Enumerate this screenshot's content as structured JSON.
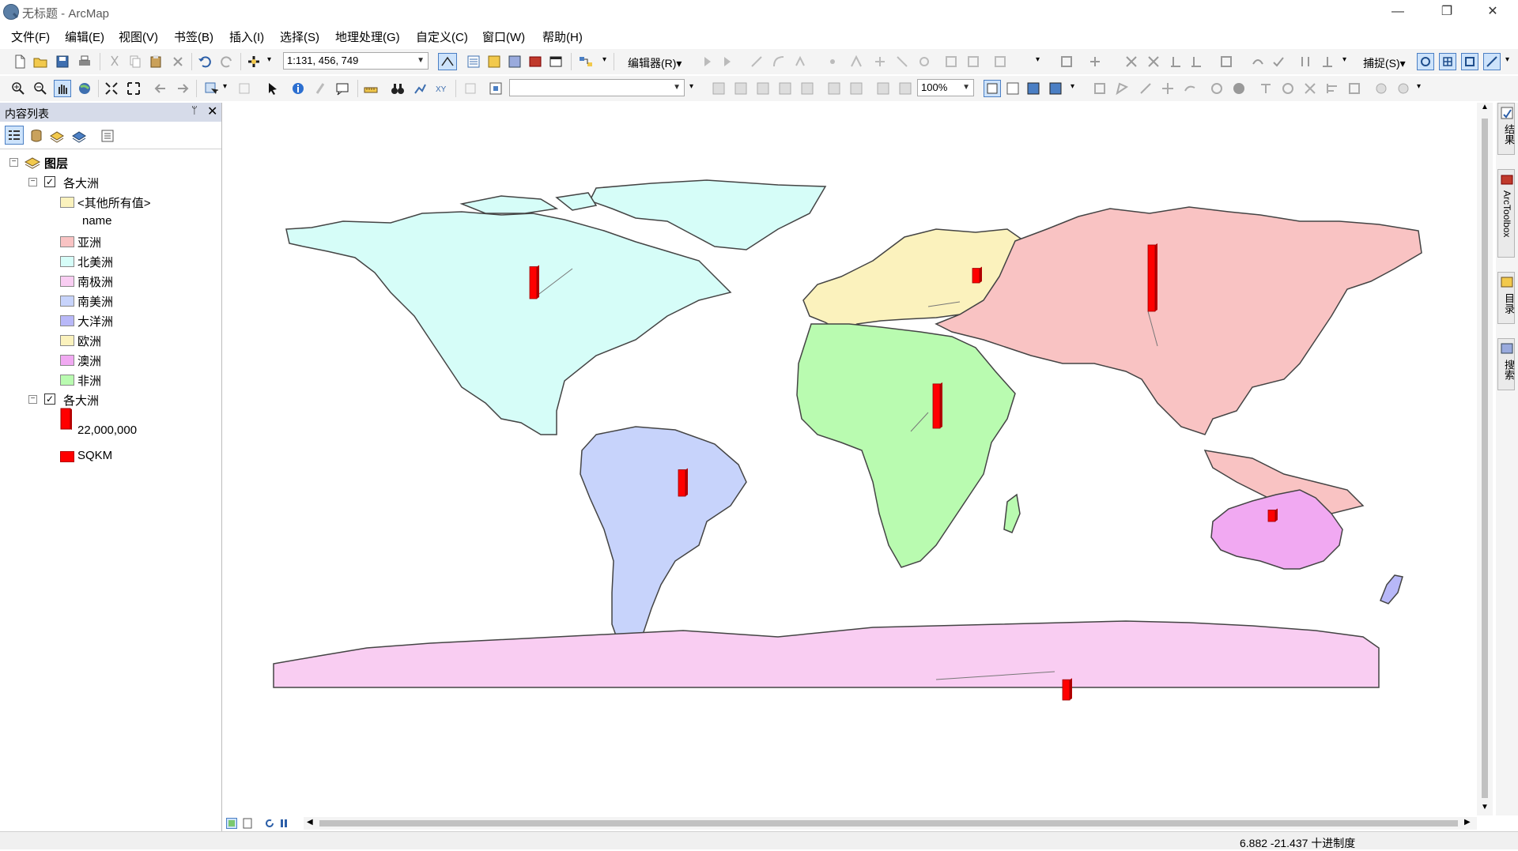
{
  "window": {
    "title": "无标题 - ArcMap",
    "minimize": "—",
    "maximize": "❐",
    "close": "✕"
  },
  "menu": [
    "文件(F)",
    "编辑(E)",
    "视图(V)",
    "书签(B)",
    "插入(I)",
    "选择(S)",
    "地理处理(G)",
    "自定义(C)",
    "窗口(W)",
    "帮助(H)"
  ],
  "toolbar": {
    "scale": "1:131, 456, 749",
    "editor_label": "编辑器(R)▾",
    "snapping_label": "捕捉(S)▾",
    "zoom_percent": "100%"
  },
  "toc": {
    "title": "内容列表",
    "pin": "ᛘ",
    "close": "✕",
    "root": "图层",
    "layer1": {
      "name": "各大洲",
      "other_values": "<其他所有值>",
      "field": "name",
      "classes": [
        {
          "label": "亚洲",
          "color": "#f9c3c3"
        },
        {
          "label": "北美洲",
          "color": "#d6fdf8"
        },
        {
          "label": "南极洲",
          "color": "#f9cdf2"
        },
        {
          "label": "南美洲",
          "color": "#c7d3fb"
        },
        {
          "label": "大洋洲",
          "color": "#b8b8f8"
        },
        {
          "label": "欧洲",
          "color": "#fbf2bd"
        },
        {
          "label": "澳洲",
          "color": "#f1a9f2"
        },
        {
          "label": "非洲",
          "color": "#b9fbb0"
        }
      ],
      "other_color": "#fbf2bd"
    },
    "layer2": {
      "name": "各大洲",
      "size_label": "22,000,000",
      "field": "SQKM",
      "bar_color": "#ff0000"
    }
  },
  "status": {
    "coords": "6.882  -21.437 十进制度"
  },
  "dock": [
    "结果",
    "ArcToolbox",
    "目录",
    "搜索"
  ],
  "chart_data": {
    "type": "bar",
    "field": "SQKM",
    "reference_value": 22000000,
    "categories": [
      "北美洲",
      "欧洲",
      "亚洲",
      "非洲",
      "南美洲",
      "澳洲",
      "南极洲"
    ],
    "values": [
      21500000,
      9800000,
      44600000,
      29800000,
      17800000,
      7700000,
      13700000
    ]
  }
}
